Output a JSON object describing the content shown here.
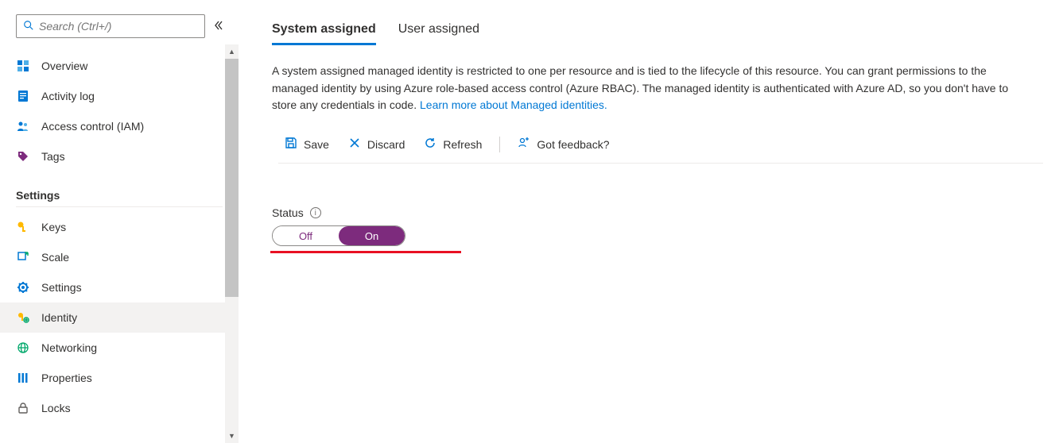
{
  "sidebar": {
    "search_placeholder": "Search (Ctrl+/)",
    "top_items": [
      {
        "label": "Overview",
        "icon": "overview"
      },
      {
        "label": "Activity log",
        "icon": "activity"
      },
      {
        "label": "Access control (IAM)",
        "icon": "access"
      },
      {
        "label": "Tags",
        "icon": "tag"
      }
    ],
    "settings_header": "Settings",
    "settings_items": [
      {
        "label": "Keys",
        "icon": "key"
      },
      {
        "label": "Scale",
        "icon": "scale"
      },
      {
        "label": "Settings",
        "icon": "gear"
      },
      {
        "label": "Identity",
        "icon": "identity",
        "selected": true
      },
      {
        "label": "Networking",
        "icon": "networking"
      },
      {
        "label": "Properties",
        "icon": "properties"
      },
      {
        "label": "Locks",
        "icon": "lock"
      }
    ]
  },
  "main": {
    "tabs": {
      "system": "System assigned",
      "user": "User assigned"
    },
    "description_text": "A system assigned managed identity is restricted to one per resource and is tied to the lifecycle of this resource. You can grant permissions to the managed identity by using Azure role-based access control (Azure RBAC). The managed identity is authenticated with Azure AD, so you don't have to store any credentials in code. ",
    "description_link": "Learn more about Managed identities.",
    "toolbar": {
      "save": "Save",
      "discard": "Discard",
      "refresh": "Refresh",
      "feedback": "Got feedback?"
    },
    "status": {
      "label": "Status",
      "off": "Off",
      "on": "On"
    }
  }
}
